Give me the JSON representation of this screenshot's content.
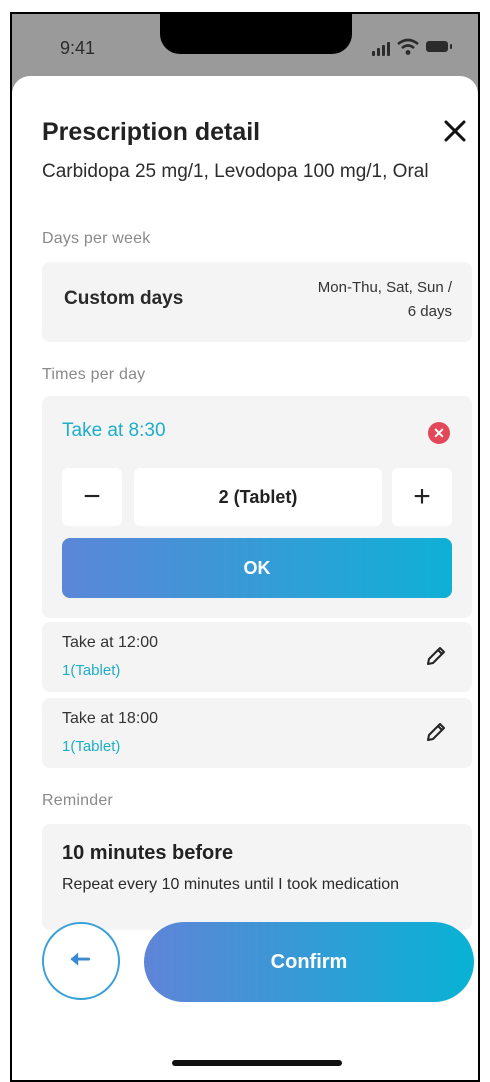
{
  "status_bar": {
    "time": "9:41"
  },
  "header": {
    "title": "Prescription detail",
    "close_icon": "close-icon"
  },
  "drug": {
    "name": "Carbidopa 25 mg/1, Levodopa 100 mg/1, Oral"
  },
  "days_per_week": {
    "label": "Days per week",
    "mode": "Custom days",
    "value_line1": "Mon-Thu, Sat, Sun /",
    "value_line2": "6 days"
  },
  "times_per_day": {
    "label": "Times per day",
    "editing": {
      "title": "Take at 8:30",
      "minus": "−",
      "quantity": "2 (Tablet)",
      "plus": "+",
      "ok_label": "OK"
    },
    "items": [
      {
        "title": "Take at 12:00",
        "dose": "1(Tablet)"
      },
      {
        "title": "Take at 18:00",
        "dose": "1(Tablet)"
      }
    ]
  },
  "reminder": {
    "label": "Reminder",
    "title": "10 minutes before",
    "detail": "Repeat every 10 minutes until I took medication"
  },
  "footer": {
    "confirm_label": "Confirm"
  },
  "colors": {
    "accent": "#1eaec9",
    "remove": "#e2475a",
    "gradient_start": "#5c86d8",
    "gradient_end": "#0fb0d6"
  }
}
